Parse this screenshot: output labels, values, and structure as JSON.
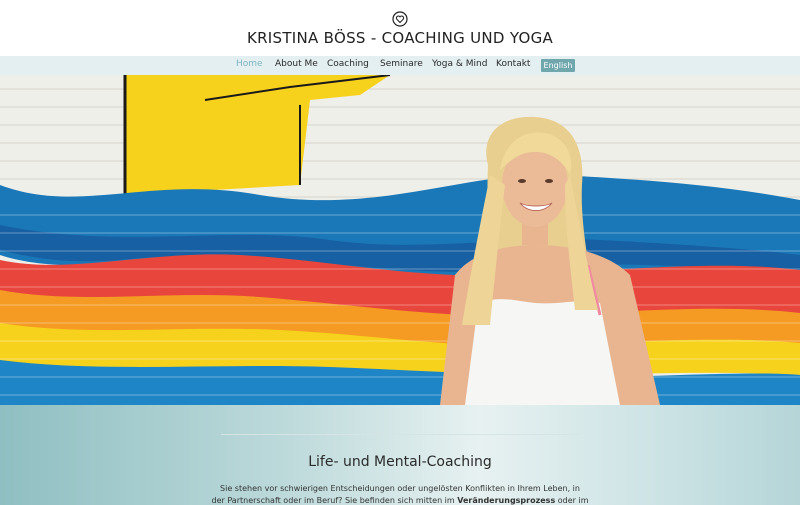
{
  "header": {
    "logo_icon": "heart-circle-icon",
    "title": "KRISTINA BÖSS - COACHING UND YOGA"
  },
  "nav": {
    "items": [
      {
        "label": "Home",
        "active": true
      },
      {
        "label": "About Me",
        "active": false
      },
      {
        "label": "Coaching",
        "active": false
      },
      {
        "label": "Seminare",
        "active": false
      },
      {
        "label": "Yoga & Mind",
        "active": false
      },
      {
        "label": "Kontakt",
        "active": false
      }
    ],
    "language_button": "English"
  },
  "hero": {
    "description_colors": {
      "yellow": "#f7d21c",
      "blue": "#1a78b8",
      "red": "#e8453c",
      "orange": "#f59a23",
      "wall": "#efefea"
    }
  },
  "main": {
    "section_title": "Life- und Mental-Coaching",
    "intro_line1": "Sie stehen vor schwierigen Entscheidungen oder ungelösten Konflikten in Ihrem Leben, in",
    "intro_line2_a": "der Partnerschaft oder im Beruf? Sie befinden sich mitten im ",
    "intro_line2_bold": "Veränderungsprozess",
    "intro_line2_b": " oder im"
  },
  "colors": {
    "accent": "#7fb6c2",
    "nav_bg": "#e4eff1",
    "button_bg": "#6fa7ad"
  }
}
